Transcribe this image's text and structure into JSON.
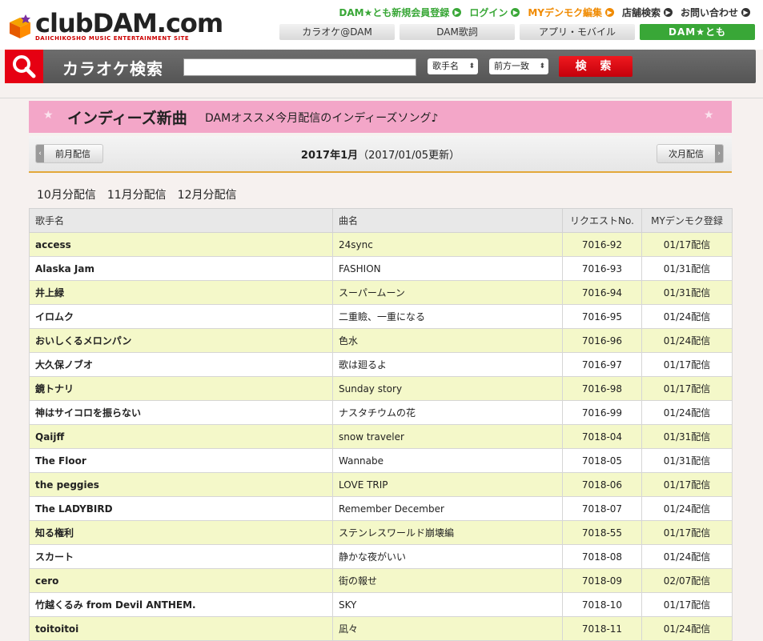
{
  "logo": {
    "text": "clubDAM.com",
    "tagline": "DAIICHIKOSHO MUSIC ENTERTAINMENT SITE"
  },
  "toplinks": [
    {
      "label": "DAM★とも新規会員登録",
      "color": "#39a737"
    },
    {
      "label": "ログイン",
      "color": "#39a737"
    },
    {
      "label": "MYデンモク編集",
      "color": "#f08a00"
    },
    {
      "label": "店舗検索",
      "color": "#333333"
    },
    {
      "label": "お問い合わせ",
      "color": "#333333"
    }
  ],
  "nav": {
    "karaoke": "カラオケ@DAM",
    "lyrics": "DAM歌詞",
    "apps": "アプリ・モバイル",
    "damtomo": "DAM★とも"
  },
  "search": {
    "title": "カラオケ検索",
    "input_value": "",
    "field_select": "歌手名",
    "match_select": "前方一致",
    "button": "検 索"
  },
  "banner": {
    "title": "インディーズ新曲",
    "subtitle": "DAMオススメ今月配信のインディーズソング♪"
  },
  "month_nav": {
    "prev": "前月配信",
    "next": "次月配信",
    "current": "2017年1月",
    "updated": "（2017/01/05更新）"
  },
  "month_links": [
    "10月分配信",
    "11月分配信",
    "12月分配信"
  ],
  "table": {
    "headers": {
      "artist": "歌手名",
      "song": "曲名",
      "request_no": "リクエストNo.",
      "mydenmoku": "MYデンモク登録"
    },
    "rows": [
      {
        "artist": "access",
        "song": "24sync",
        "request_no": "7016-92",
        "mydenmoku": "01/17配信"
      },
      {
        "artist": "Alaska Jam",
        "song": "FASHION",
        "request_no": "7016-93",
        "mydenmoku": "01/31配信"
      },
      {
        "artist": "井上緑",
        "song": "スーパームーン",
        "request_no": "7016-94",
        "mydenmoku": "01/31配信"
      },
      {
        "artist": "イロムク",
        "song": "二重瞼、一重になる",
        "request_no": "7016-95",
        "mydenmoku": "01/24配信"
      },
      {
        "artist": "おいしくるメロンパン",
        "song": "色水",
        "request_no": "7016-96",
        "mydenmoku": "01/24配信"
      },
      {
        "artist": "大久保ノブオ",
        "song": "歌は廻るよ",
        "request_no": "7016-97",
        "mydenmoku": "01/17配信"
      },
      {
        "artist": "鏡トナリ",
        "song": "Sunday story",
        "request_no": "7016-98",
        "mydenmoku": "01/17配信"
      },
      {
        "artist": "神はサイコロを振らない",
        "song": "ナスタチウムの花",
        "request_no": "7016-99",
        "mydenmoku": "01/24配信"
      },
      {
        "artist": "Qaijff",
        "song": "snow traveler",
        "request_no": "7018-04",
        "mydenmoku": "01/31配信"
      },
      {
        "artist": "The Floor",
        "song": "Wannabe",
        "request_no": "7018-05",
        "mydenmoku": "01/31配信"
      },
      {
        "artist": "the peggies",
        "song": "LOVE TRIP",
        "request_no": "7018-06",
        "mydenmoku": "01/17配信"
      },
      {
        "artist": "The LADYBIRD",
        "song": "Remember December",
        "request_no": "7018-07",
        "mydenmoku": "01/24配信"
      },
      {
        "artist": "知る権利",
        "song": "ステンレスワールド崩壊編",
        "request_no": "7018-55",
        "mydenmoku": "01/17配信"
      },
      {
        "artist": "スカート",
        "song": "静かな夜がいい",
        "request_no": "7018-08",
        "mydenmoku": "01/24配信"
      },
      {
        "artist": "cero",
        "song": "街の報せ",
        "request_no": "7018-09",
        "mydenmoku": "02/07配信"
      },
      {
        "artist": "竹越くるみ from Devil ANTHEM.",
        "song": "SKY",
        "request_no": "7018-10",
        "mydenmoku": "01/17配信"
      },
      {
        "artist": "toitoitoi",
        "song": "凪々",
        "request_no": "7018-11",
        "mydenmoku": "01/24配信"
      }
    ]
  }
}
